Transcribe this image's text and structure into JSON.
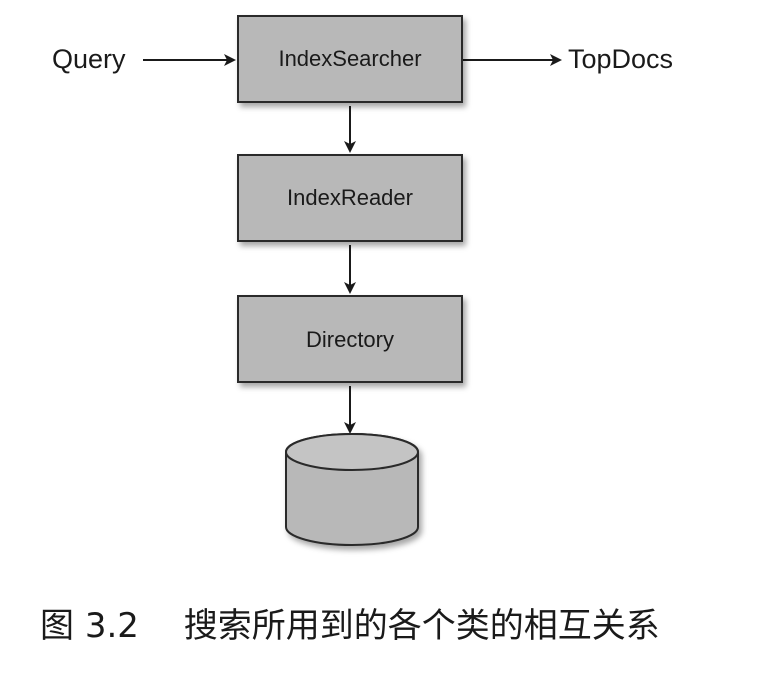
{
  "diagram": {
    "input_label": "Query",
    "output_label": "TopDocs",
    "nodes": [
      {
        "id": "index-searcher",
        "label": "IndexSearcher"
      },
      {
        "id": "index-reader",
        "label": "IndexReader"
      },
      {
        "id": "directory",
        "label": "Directory"
      }
    ],
    "storage": {
      "shape": "cylinder-icon"
    },
    "colors": {
      "box_fill": "#b8b8b8",
      "box_stroke": "#2a2a2a",
      "arrow": "#1a1a1a",
      "background": "#ffffff"
    }
  },
  "caption": {
    "prefix": "图",
    "number": "3.2",
    "text": "搜索所用到的各个类的相互关系"
  }
}
